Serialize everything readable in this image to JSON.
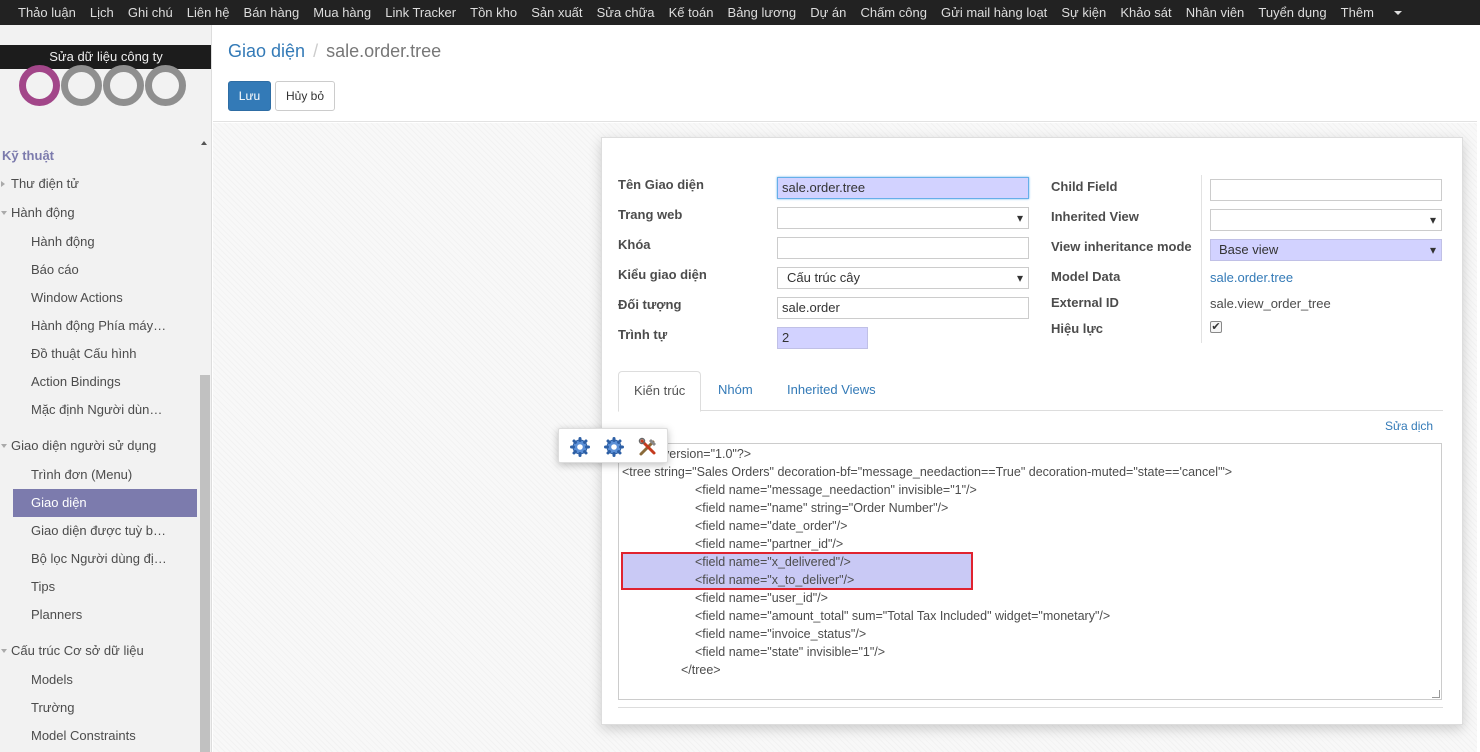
{
  "top_menu": [
    "Thảo luận",
    "Lịch",
    "Ghi chú",
    "Liên hệ",
    "Bán hàng",
    "Mua hàng",
    "Link Tracker",
    "Tồn kho",
    "Sản xuất",
    "Sửa chữa",
    "Kế toán",
    "Bảng lương",
    "Dự án",
    "Chấm công",
    "Gửi mail hàng loạt",
    "Sự kiện",
    "Khảo sát",
    "Nhân viên",
    "Tuyển dụng",
    "Thêm"
  ],
  "sidebar": {
    "logo_label": "Sửa dữ liệu công ty",
    "section": "Kỹ thuật",
    "items": [
      {
        "label": "Thư điện tử",
        "type": "group-collapsed"
      },
      {
        "label": "Hành động",
        "type": "group"
      },
      {
        "label": "Hành động",
        "type": "sub"
      },
      {
        "label": "Báo cáo",
        "type": "sub"
      },
      {
        "label": "Window Actions",
        "type": "sub"
      },
      {
        "label": "Hành động Phía máy…",
        "type": "sub"
      },
      {
        "label": "Đồ thuật Cấu hình",
        "type": "sub"
      },
      {
        "label": "Action Bindings",
        "type": "sub"
      },
      {
        "label": "Mặc định Người dùn…",
        "type": "sub"
      },
      {
        "label": "Giao diện người sử dụng",
        "type": "group"
      },
      {
        "label": "Trình đơn (Menu)",
        "type": "sub"
      },
      {
        "label": "Giao diện",
        "type": "active"
      },
      {
        "label": "Giao diện được tuỳ b…",
        "type": "sub"
      },
      {
        "label": "Bộ lọc Người dùng đị…",
        "type": "sub"
      },
      {
        "label": "Tips",
        "type": "sub"
      },
      {
        "label": "Planners",
        "type": "sub"
      },
      {
        "label": "Cấu trúc Cơ sở dữ liệu",
        "type": "group"
      },
      {
        "label": "Models",
        "type": "sub"
      },
      {
        "label": "Trường",
        "type": "sub"
      },
      {
        "label": "Model Constraints",
        "type": "sub"
      }
    ]
  },
  "breadcrumb": {
    "parent": "Giao diện",
    "current": "sale.order.tree"
  },
  "buttons": {
    "save": "Lưu",
    "cancel": "Hủy bỏ"
  },
  "form": {
    "left": {
      "view_name_label": "Tên Giao diện",
      "view_name": "sale.order.tree",
      "website_label": "Trang web",
      "website": "",
      "key_label": "Khóa",
      "key": "",
      "view_type_label": "Kiểu giao diện",
      "view_type": "Cấu trúc cây",
      "model_label": "Đối tượng",
      "model": "sale.order",
      "sequence_label": "Trình tự",
      "sequence": "2"
    },
    "right": {
      "child_field_label": "Child Field",
      "child_field": "",
      "inherited_view_label": "Inherited View",
      "inherited_view": "",
      "inheritance_mode_label": "View inheritance mode",
      "inheritance_mode": "Base view",
      "model_data_label": "Model Data",
      "model_data": "sale.order.tree",
      "external_id_label": "External ID",
      "external_id": "sale.view_order_tree",
      "active_label": "Hiệu lực",
      "active": true
    }
  },
  "tabs": [
    "Kiến trúc",
    "Nhóm",
    "Inherited Views"
  ],
  "translate_link": "Sửa dịch",
  "code_lines": [
    "version=\"1.0\"?>",
    "<tree string=\"Sales Orders\" decoration-bf=\"message_needaction==True\" decoration-muted=\"state=='cancel'\">",
    "<field name=\"message_needaction\" invisible=\"1\"/>",
    "<field name=\"name\" string=\"Order Number\"/>",
    "<field name=\"date_order\"/>",
    "<field name=\"partner_id\"/>",
    "<field name=\"x_delivered\"/>",
    "<field name=\"x_to_deliver\"/>",
    "<field name=\"user_id\"/>",
    "<field name=\"amount_total\" sum=\"Total Tax Included\" widget=\"monetary\"/>",
    "<field name=\"invoice_status\"/>",
    "<field name=\"state\" invisible=\"1\"/>",
    "</tree>"
  ],
  "colors": {
    "topbar": "#222222",
    "accent": "#7c7bad",
    "link": "#337ab7",
    "required": "#d2d2ff",
    "highlight_border": "#e0232f"
  }
}
